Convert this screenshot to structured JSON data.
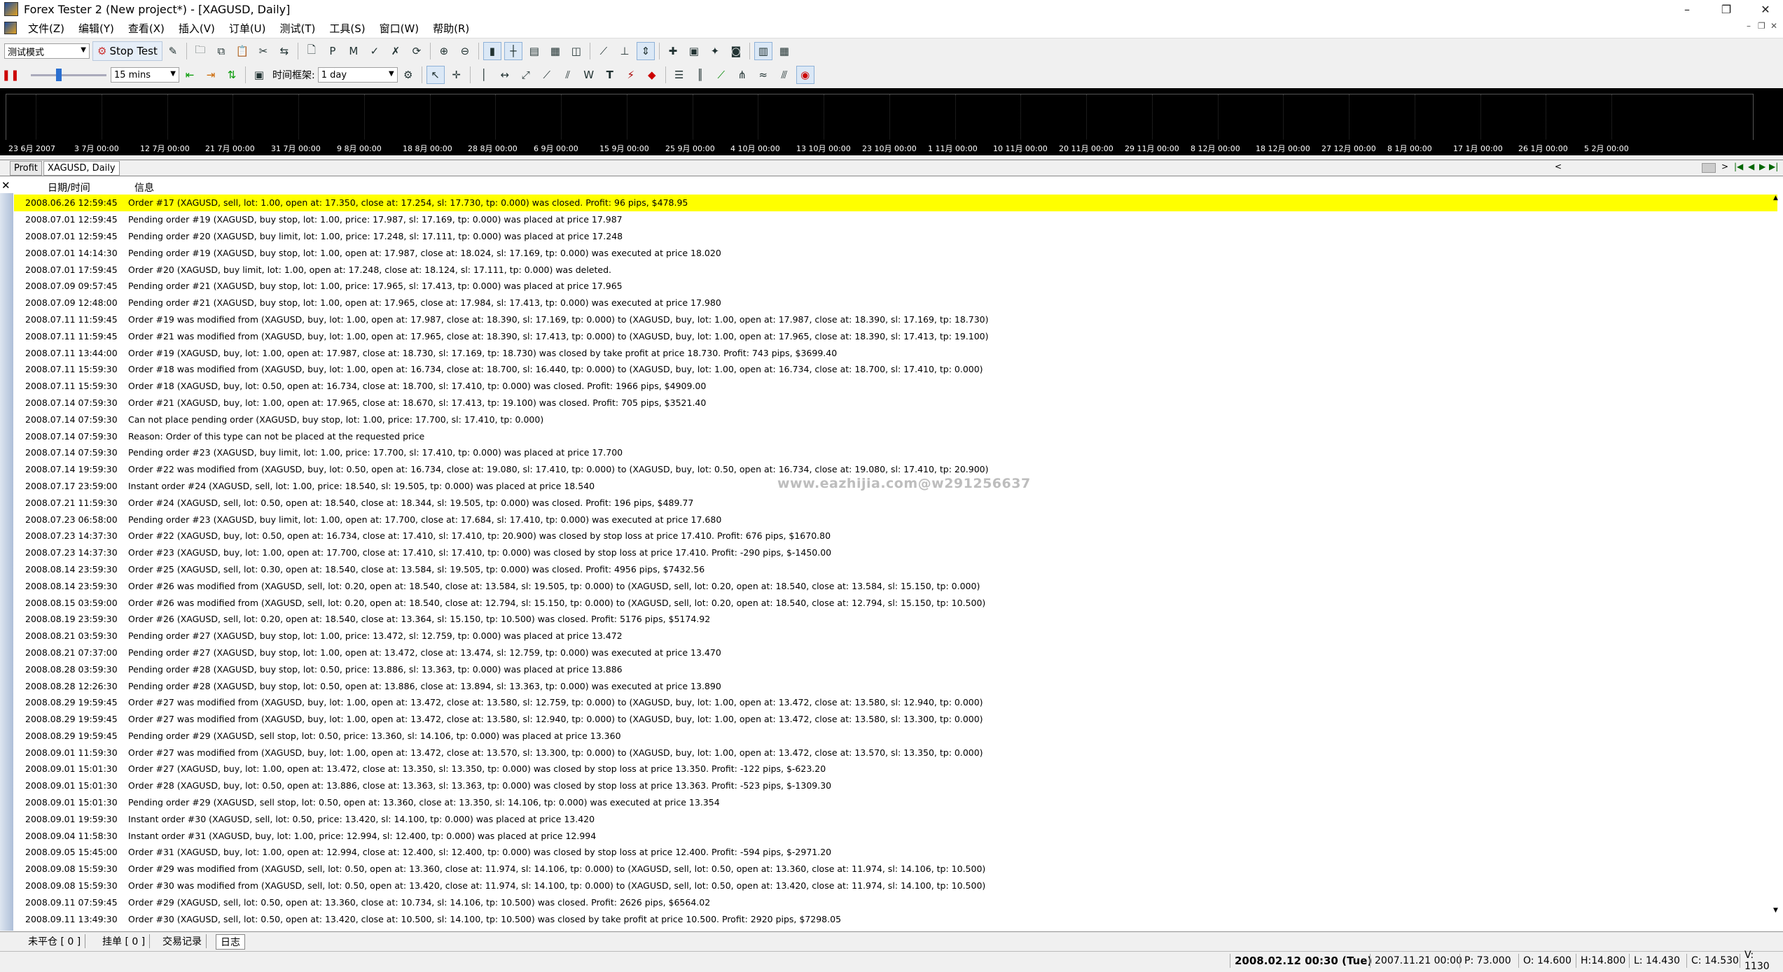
{
  "window": {
    "title": "Forex Tester 2  (New project*) - [XAGUSD, Daily]",
    "minimize": "–",
    "restore": "❐",
    "close": "✕"
  },
  "menu": [
    "文件(Z)",
    "编辑(Y)",
    "查看(X)",
    "插入(V)",
    "订单(U)",
    "测试(T)",
    "工具(S)",
    "窗口(W)",
    "帮助(R)"
  ],
  "toolbar1": {
    "mode_select": "测试模式",
    "stop_test_label": "Stop Test"
  },
  "toolbar2": {
    "interval_select": "15 mins",
    "timeframe_label": "时间框架:",
    "timeframe_select": "1 day"
  },
  "chart": {
    "time_axis": [
      "23 6月 2007",
      "3 7月 00:00",
      "12 7月 00:00",
      "21 7月 00:00",
      "31 7月 00:00",
      "9 8月 00:00",
      "18 8月 00:00",
      "28 8月 00:00",
      "6 9月 00:00",
      "15 9月 00:00",
      "25 9月 00:00",
      "4 10月 00:00",
      "13 10月 00:00",
      "23 10月 00:00",
      "1 11月 00:00",
      "10 11月 00:00",
      "20 11月 00:00",
      "29 11月 00:00",
      "8 12月 00:00",
      "18 12月 00:00",
      "27 12月 00:00",
      "8 1月 00:00",
      "17 1月 00:00",
      "26 1月 00:00",
      "5 2月 00:00"
    ]
  },
  "chart_tabs": [
    "Profit",
    "XAGUSD, Daily"
  ],
  "log": {
    "col_datetime": "日期/时间",
    "col_message": "信息",
    "watermark": "www.eazhijia.com@w291256637",
    "rows": [
      {
        "dt": "2008.06.26 12:59:45",
        "msg": "Order #17 (XAGUSD, sell, lot: 1.00, open at: 17.350, close at: 17.254, sl: 17.730, tp: 0.000) was closed. Profit: 96 pips, $478.95",
        "highlight": true
      },
      {
        "dt": "2008.07.01 12:59:45",
        "msg": "Pending order #19 (XAGUSD, buy stop, lot: 1.00, price: 17.987, sl: 17.169, tp: 0.000) was placed at price 17.987"
      },
      {
        "dt": "2008.07.01 12:59:45",
        "msg": "Pending order #20 (XAGUSD, buy limit, lot: 1.00, price: 17.248, sl: 17.111, tp: 0.000) was placed at price 17.248"
      },
      {
        "dt": "2008.07.01 14:14:30",
        "msg": "Pending order #19 (XAGUSD, buy stop, lot: 1.00, open at: 17.987, close at: 18.024, sl: 17.169, tp: 0.000) was executed at price 18.020"
      },
      {
        "dt": "2008.07.01 17:59:45",
        "msg": "Order #20 (XAGUSD, buy limit, lot: 1.00, open at: 17.248, close at: 18.124, sl: 17.111, tp: 0.000) was deleted."
      },
      {
        "dt": "2008.07.09 09:57:45",
        "msg": "Pending order #21 (XAGUSD, buy stop, lot: 1.00, price: 17.965, sl: 17.413, tp: 0.000) was placed at price 17.965"
      },
      {
        "dt": "2008.07.09 12:48:00",
        "msg": "Pending order #21 (XAGUSD, buy stop, lot: 1.00, open at: 17.965, close at: 17.984, sl: 17.413, tp: 0.000) was executed at price 17.980"
      },
      {
        "dt": "2008.07.11 11:59:45",
        "msg": "Order #19 was modified from (XAGUSD, buy, lot: 1.00, open at: 17.987, close at: 18.390, sl: 17.169, tp: 0.000) to (XAGUSD, buy, lot: 1.00, open at: 17.987, close at: 18.390, sl: 17.169, tp: 18.730)"
      },
      {
        "dt": "2008.07.11 11:59:45",
        "msg": "Order #21 was modified from (XAGUSD, buy, lot: 1.00, open at: 17.965, close at: 18.390, sl: 17.413, tp: 0.000) to (XAGUSD, buy, lot: 1.00, open at: 17.965, close at: 18.390, sl: 17.413, tp: 19.100)"
      },
      {
        "dt": "2008.07.11 13:44:00",
        "msg": "Order #19 (XAGUSD, buy, lot: 1.00, open at: 17.987, close at: 18.730, sl: 17.169, tp: 18.730) was closed by take profit at price 18.730. Profit: 743 pips, $3699.40"
      },
      {
        "dt": "2008.07.11 15:59:30",
        "msg": "Order #18 was modified from (XAGUSD, buy, lot: 1.00, open at: 16.734, close at: 18.700, sl: 16.440, tp: 0.000) to (XAGUSD, buy, lot: 1.00, open at: 16.734, close at: 18.700, sl: 17.410, tp: 0.000)"
      },
      {
        "dt": "2008.07.11 15:59:30",
        "msg": "Order #18 (XAGUSD, buy, lot: 0.50, open at: 16.734, close at: 18.700, sl: 17.410, tp: 0.000) was closed. Profit: 1966 pips, $4909.00"
      },
      {
        "dt": "2008.07.14 07:59:30",
        "msg": "Order #21 (XAGUSD, buy, lot: 1.00, open at: 17.965, close at: 18.670, sl: 17.413, tp: 19.100) was closed. Profit: 705 pips, $3521.40"
      },
      {
        "dt": "2008.07.14 07:59:30",
        "msg": "Can not place pending order (XAGUSD, buy stop, lot: 1.00, price: 17.700, sl: 17.410, tp: 0.000)"
      },
      {
        "dt": "2008.07.14 07:59:30",
        "msg": "Reason: Order of this type can not be placed at the requested price"
      },
      {
        "dt": "2008.07.14 07:59:30",
        "msg": "Pending order #23 (XAGUSD, buy limit, lot: 1.00, price: 17.700, sl: 17.410, tp: 0.000) was placed at price 17.700"
      },
      {
        "dt": "2008.07.14 19:59:30",
        "msg": "Order #22 was modified from (XAGUSD, buy, lot: 0.50, open at: 16.734, close at: 19.080, sl: 17.410, tp: 0.000) to (XAGUSD, buy, lot: 0.50, open at: 16.734, close at: 19.080, sl: 17.410, tp: 20.900)"
      },
      {
        "dt": "2008.07.17 23:59:00",
        "msg": "Instant order #24 (XAGUSD, sell, lot: 1.00, price: 18.540, sl: 19.505, tp: 0.000) was placed at price 18.540"
      },
      {
        "dt": "2008.07.21 11:59:30",
        "msg": "Order #24 (XAGUSD, sell, lot: 0.50, open at: 18.540, close at: 18.344, sl: 19.505, tp: 0.000) was closed. Profit: 196 pips, $489.77"
      },
      {
        "dt": "2008.07.23 06:58:00",
        "msg": "Pending order #23 (XAGUSD, buy limit, lot: 1.00, open at: 17.700, close at: 17.684, sl: 17.410, tp: 0.000) was executed at price 17.680"
      },
      {
        "dt": "2008.07.23 14:37:30",
        "msg": "Order #22 (XAGUSD, buy, lot: 0.50, open at: 16.734, close at: 17.410, sl: 17.410, tp: 20.900) was closed by stop loss at price 17.410. Profit: 676 pips, $1670.80"
      },
      {
        "dt": "2008.07.23 14:37:30",
        "msg": "Order #23 (XAGUSD, buy, lot: 1.00, open at: 17.700, close at: 17.410, sl: 17.410, tp: 0.000) was closed by stop loss at price 17.410. Profit: -290 pips, $-1450.00"
      },
      {
        "dt": "2008.08.14 23:59:30",
        "msg": "Order #25 (XAGUSD, sell, lot: 0.30, open at: 18.540, close at: 13.584, sl: 19.505, tp: 0.000) was closed. Profit: 4956 pips, $7432.56"
      },
      {
        "dt": "2008.08.14 23:59:30",
        "msg": "Order #26 was modified from (XAGUSD, sell, lot: 0.20, open at: 18.540, close at: 13.584, sl: 19.505, tp: 0.000) to (XAGUSD, sell, lot: 0.20, open at: 18.540, close at: 13.584, sl: 15.150, tp: 0.000)"
      },
      {
        "dt": "2008.08.15 03:59:00",
        "msg": "Order #26 was modified from (XAGUSD, sell, lot: 0.20, open at: 18.540, close at: 12.794, sl: 15.150, tp: 0.000) to (XAGUSD, sell, lot: 0.20, open at: 18.540, close at: 12.794, sl: 15.150, tp: 10.500)"
      },
      {
        "dt": "2008.08.19 23:59:30",
        "msg": "Order #26 (XAGUSD, sell, lot: 0.20, open at: 18.540, close at: 13.364, sl: 15.150, tp: 10.500) was closed. Profit: 5176 pips, $5174.92"
      },
      {
        "dt": "2008.08.21 03:59:30",
        "msg": "Pending order #27 (XAGUSD, buy stop, lot: 1.00, price: 13.472, sl: 12.759, tp: 0.000) was placed at price 13.472"
      },
      {
        "dt": "2008.08.21 07:37:00",
        "msg": "Pending order #27 (XAGUSD, buy stop, lot: 1.00, open at: 13.472, close at: 13.474, sl: 12.759, tp: 0.000) was executed at price 13.470"
      },
      {
        "dt": "2008.08.28 03:59:30",
        "msg": "Pending order #28 (XAGUSD, buy stop, lot: 0.50, price: 13.886, sl: 13.363, tp: 0.000) was placed at price 13.886"
      },
      {
        "dt": "2008.08.28 12:26:30",
        "msg": "Pending order #28 (XAGUSD, buy stop, lot: 0.50, open at: 13.886, close at: 13.894, sl: 13.363, tp: 0.000) was executed at price 13.890"
      },
      {
        "dt": "2008.08.29 19:59:45",
        "msg": "Order #27 was modified from (XAGUSD, buy, lot: 1.00, open at: 13.472, close at: 13.580, sl: 12.759, tp: 0.000) to (XAGUSD, buy, lot: 1.00, open at: 13.472, close at: 13.580, sl: 12.940, tp: 0.000)"
      },
      {
        "dt": "2008.08.29 19:59:45",
        "msg": "Order #27 was modified from (XAGUSD, buy, lot: 1.00, open at: 13.472, close at: 13.580, sl: 12.940, tp: 0.000) to (XAGUSD, buy, lot: 1.00, open at: 13.472, close at: 13.580, sl: 13.300, tp: 0.000)"
      },
      {
        "dt": "2008.08.29 19:59:45",
        "msg": "Pending order #29 (XAGUSD, sell stop, lot: 0.50, price: 13.360, sl: 14.106, tp: 0.000) was placed at price 13.360"
      },
      {
        "dt": "2008.09.01 11:59:30",
        "msg": "Order #27 was modified from (XAGUSD, buy, lot: 1.00, open at: 13.472, close at: 13.570, sl: 13.300, tp: 0.000) to (XAGUSD, buy, lot: 1.00, open at: 13.472, close at: 13.570, sl: 13.350, tp: 0.000)"
      },
      {
        "dt": "2008.09.01 15:01:30",
        "msg": "Order #27 (XAGUSD, buy, lot: 1.00, open at: 13.472, close at: 13.350, sl: 13.350, tp: 0.000) was closed by stop loss at price 13.350. Profit: -122 pips, $-623.20"
      },
      {
        "dt": "2008.09.01 15:01:30",
        "msg": "Order #28 (XAGUSD, buy, lot: 0.50, open at: 13.886, close at: 13.363, sl: 13.363, tp: 0.000) was closed by stop loss at price 13.363. Profit: -523 pips, $-1309.30"
      },
      {
        "dt": "2008.09.01 15:01:30",
        "msg": "Pending order #29 (XAGUSD, sell stop, lot: 0.50, open at: 13.360, close at: 13.350, sl: 14.106, tp: 0.000) was executed at price 13.354"
      },
      {
        "dt": "2008.09.01 19:59:30",
        "msg": "Instant order #30 (XAGUSD, sell, lot: 0.50, price: 13.420, sl: 14.100, tp: 0.000) was placed at price 13.420"
      },
      {
        "dt": "2008.09.04 11:58:30",
        "msg": "Instant order #31 (XAGUSD, buy, lot: 1.00, price: 12.994, sl: 12.400, tp: 0.000) was placed at price 12.994"
      },
      {
        "dt": "2008.09.05 15:45:00",
        "msg": "Order #31 (XAGUSD, buy, lot: 1.00, open at: 12.994, close at: 12.400, sl: 12.400, tp: 0.000) was closed by stop loss at price 12.400. Profit: -594 pips, $-2971.20"
      },
      {
        "dt": "2008.09.08 15:59:30",
        "msg": "Order #29 was modified from (XAGUSD, sell, lot: 0.50, open at: 13.360, close at: 11.974, sl: 14.106, tp: 0.000) to (XAGUSD, sell, lot: 0.50, open at: 13.360, close at: 11.974, sl: 14.106, tp: 10.500)"
      },
      {
        "dt": "2008.09.08 15:59:30",
        "msg": "Order #30 was modified from (XAGUSD, sell, lot: 0.50, open at: 13.420, close at: 11.974, sl: 14.100, tp: 0.000) to (XAGUSD, sell, lot: 0.50, open at: 13.420, close at: 11.974, sl: 14.100, tp: 10.500)"
      },
      {
        "dt": "2008.09.11 07:59:45",
        "msg": "Order #29 (XAGUSD, sell, lot: 0.50, open at: 13.360, close at: 10.734, sl: 14.106, tp: 10.500) was closed. Profit: 2626 pips, $6564.02"
      },
      {
        "dt": "2008.09.11 13:49:30",
        "msg": "Order #30 (XAGUSD, sell, lot: 0.50, open at: 13.420, close at: 10.500, sl: 14.100, tp: 10.500) was closed by take profit at price 10.500. Profit: 2920 pips, $7298.05"
      }
    ]
  },
  "bottom_tabs": [
    "未平仓 [ 0 ]",
    "挂单 [ 0 ]",
    "交易记录",
    "日志"
  ],
  "status": {
    "current_time": "2008.02.12 00:30 (Tue)",
    "bar_time": "2007.11.21 00:00",
    "p": "P: 73.000",
    "o": "O: 14.600",
    "h": "H:14.800",
    "l": "L: 14.430",
    "c": "C: 14.530",
    "v": "V: 1130"
  },
  "colors": {
    "highlight_row": "#ffff00",
    "chart_bg": "#000000"
  }
}
